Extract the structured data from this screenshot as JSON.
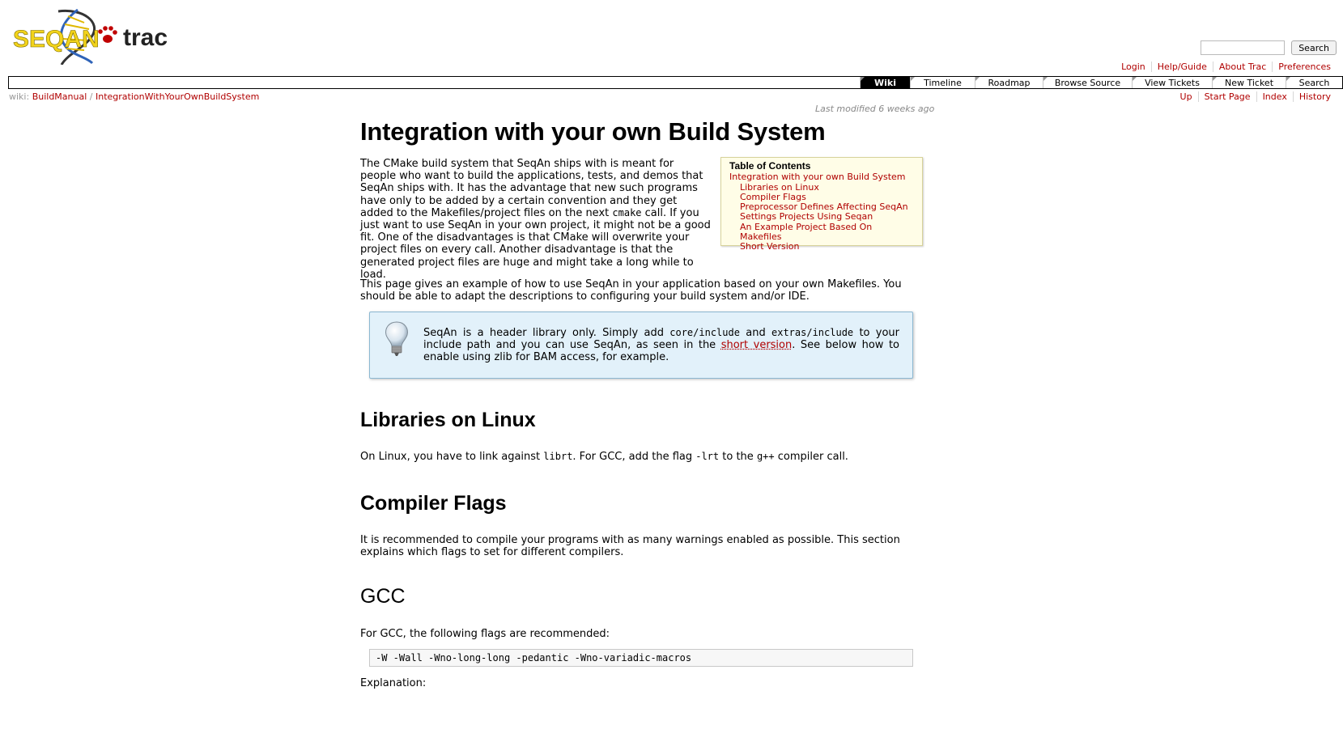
{
  "header": {
    "logo_left": "SEQAN",
    "logo_right": "trac",
    "search_placeholder": "",
    "search_button": "Search",
    "metanav": [
      "Login",
      "Help/Guide",
      "About Trac",
      "Preferences"
    ]
  },
  "mainnav": {
    "items": [
      {
        "label": "Wiki",
        "active": true
      },
      {
        "label": "Timeline",
        "active": false
      },
      {
        "label": "Roadmap",
        "active": false
      },
      {
        "label": "Browse Source",
        "active": false
      },
      {
        "label": "View Tickets",
        "active": false
      },
      {
        "label": "New Ticket",
        "active": false
      },
      {
        "label": "Search",
        "active": false
      }
    ]
  },
  "breadcrumb": {
    "prefix": "wiki:",
    "parent": "BuildManual",
    "separator": "/",
    "current": "IntegrationWithYourOwnBuildSystem"
  },
  "ctxtnav": [
    "Up",
    "Start Page",
    "Index",
    "History"
  ],
  "last_modified": {
    "prefix": "Last modified",
    "ago": "6 weeks ago"
  },
  "page": {
    "title": "Integration with your own Build System",
    "intro_part1": "The CMake build system that SeqAn ships with is meant for people who want to build the applications, tests, and demos that SeqAn ships with. It has the advantage that new such programs have only to be added by a certain convention and they get added to the Makefiles/project files on the next ",
    "intro_code": "cmake",
    "intro_part2": " call. If you just want to use SeqAn in your own project, it might not be a good fit. One of the disadvantages is that CMake will overwrite your project files on every call. Another disadvantage is that the generated project files are huge and might take a long while to load.",
    "para2": "This page gives an example of how to use SeqAn in your application based on your own Makefiles. You should be able to adapt the descriptions to configuring your build system and/or IDE.",
    "tip": {
      "t1": "SeqAn is a header library only. Simply add ",
      "c1": "core/include",
      "t2": " and ",
      "c2": "extras/include",
      "t3": " to your include path and you can use SeqAn, as seen in the ",
      "link": "short version",
      "t4": ". See below how to enable using zlib for BAM access, for example."
    },
    "h_libraries": "Libraries on Linux",
    "libraries": {
      "t1": "On Linux, you have to link against ",
      "c1": "librt",
      "t2": ". For GCC, add the flag ",
      "c2": "-lrt",
      "t3": " to the ",
      "c3": "g++",
      "t4": " compiler call."
    },
    "h_compiler": "Compiler Flags",
    "compiler_para": "It is recommended to compile your programs with as many warnings enabled as possible. This section explains which flags to set for different compilers.",
    "h_gcc": "GCC",
    "gcc_para": "For GCC, the following flags are recommended:",
    "gcc_code": "-W -Wall -Wno-long-long -pedantic -Wno-variadic-macros",
    "explanation": "Explanation:"
  },
  "toc": {
    "title": "Table of Contents",
    "top": "Integration with your own Build System",
    "items": [
      "Libraries on Linux",
      "Compiler Flags",
      "Preprocessor Defines Affecting SeqAn",
      "Settings Projects Using Seqan",
      "An Example Project Based On Makefiles",
      "Short Version"
    ]
  },
  "colors": {
    "link": "#b00000",
    "tip_bg": "#e2f1fa",
    "toc_bg": "#fffde7",
    "logo_yellow": "#f2d31b",
    "logo_blue": "#2f63b8"
  }
}
